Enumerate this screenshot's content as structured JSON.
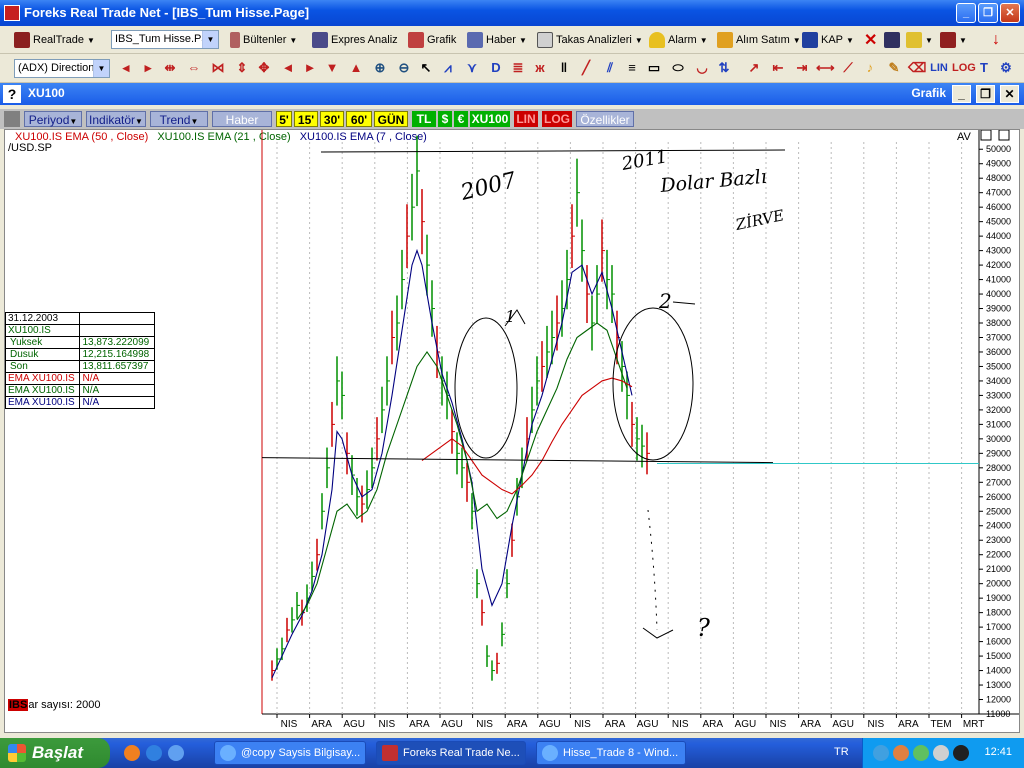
{
  "window": {
    "title": "Foreks Real Trade Net - [IBS_Tum Hisse.Page]"
  },
  "toolbar1": {
    "realtrade": "RealTrade",
    "page_combo": "IBS_Tum Hisse.Pa",
    "bultenler": "Bültenler",
    "expres_analiz": "Expres Analiz",
    "grafik": "Grafik",
    "haber": "Haber",
    "takas": "Takas Analizleri",
    "alarm": "Alarm",
    "alim_satim": "Alım Satım",
    "kap": "KAP"
  },
  "toolbar2": {
    "indicator_combo": "(ADX) Direction",
    "lin": "LIN",
    "log": "LOG"
  },
  "inner_window": {
    "symbol": "XU100",
    "label": "Grafik"
  },
  "chart_toolbar": {
    "periyod": "Periyod",
    "indikator": "Indikatör",
    "trend": "Trend",
    "haber": "Haber",
    "periods": [
      "5'",
      "15'",
      "30'",
      "60'",
      "GÜN"
    ],
    "tl": "TL",
    "usd": "$",
    "eur": "€",
    "xu100": "XU100",
    "lin": "LIN",
    "log": "LOG",
    "ozellikler": "Özellikler"
  },
  "legend": {
    "ema50": "XU100.IS EMA (50 , Close)",
    "ema21": "XU100.IS EMA (21 , Close)",
    "ema7": "XU100.IS EMA (7 , Close)",
    "divisor": "/USD.SP",
    "av": "AV"
  },
  "data_table": {
    "date": "31.12.2003",
    "symbol": "XU100.IS",
    "rows": [
      {
        "label": "Yuksek",
        "value": "13,873.222099"
      },
      {
        "label": "Dusuk",
        "value": "12,215.164998"
      },
      {
        "label": "Son",
        "value": "13,811.657397"
      }
    ],
    "ema_rows": [
      {
        "label": "EMA XU100.IS",
        "value": "N/A"
      },
      {
        "label": "EMA XU100.IS",
        "value": "N/A"
      },
      {
        "label": "EMA XU100.IS",
        "value": "N/A"
      }
    ]
  },
  "bar_count": {
    "logo": "IBS",
    "text": "ar sayısı: 2000"
  },
  "annotations": {
    "y2007": "2007",
    "y2011": "2011",
    "dolar": "Dolar Bazlı",
    "zirve": "ZİRVE",
    "one": "1",
    "two": "2",
    "q": "?"
  },
  "chart_data": {
    "type": "bar",
    "y_ticks": [
      11000,
      12000,
      13000,
      14000,
      15000,
      16000,
      17000,
      18000,
      19000,
      20000,
      21000,
      22000,
      23000,
      24000,
      25000,
      26000,
      27000,
      28000,
      29000,
      30000,
      31000,
      32000,
      33000,
      34000,
      35000,
      36000,
      37000,
      38000,
      39000,
      40000,
      41000,
      42000,
      43000,
      44000,
      45000,
      46000,
      47000,
      48000,
      49000,
      50000
    ],
    "ylim": [
      11000,
      50500
    ],
    "x_ticks": [
      "NIS",
      "ARA",
      "AGU",
      "NIS",
      "ARA",
      "AGU",
      "NIS",
      "ARA",
      "AGU",
      "NIS",
      "ARA",
      "AGU",
      "NIS",
      "ARA",
      "AGU",
      "NIS",
      "ARA",
      "AGU",
      "NIS",
      "ARA",
      "TEM",
      "MRT"
    ],
    "support_level": 28500,
    "current_level": 28300,
    "series": [
      {
        "name": "XU100.IS EMA (50 , Close)",
        "color": "#cc0000"
      },
      {
        "name": "XU100.IS EMA (21 , Close)",
        "color": "#006400"
      },
      {
        "name": "XU100.IS EMA (7 , Close)",
        "color": "#000080"
      }
    ]
  },
  "taskbar": {
    "start": "Başlat",
    "tasks": [
      "@copy Saysis Bilgisay...",
      "Foreks Real Trade Ne...",
      "Hisse_Trade 8 - Wind..."
    ],
    "lang": "TR",
    "clock": "12:41"
  }
}
